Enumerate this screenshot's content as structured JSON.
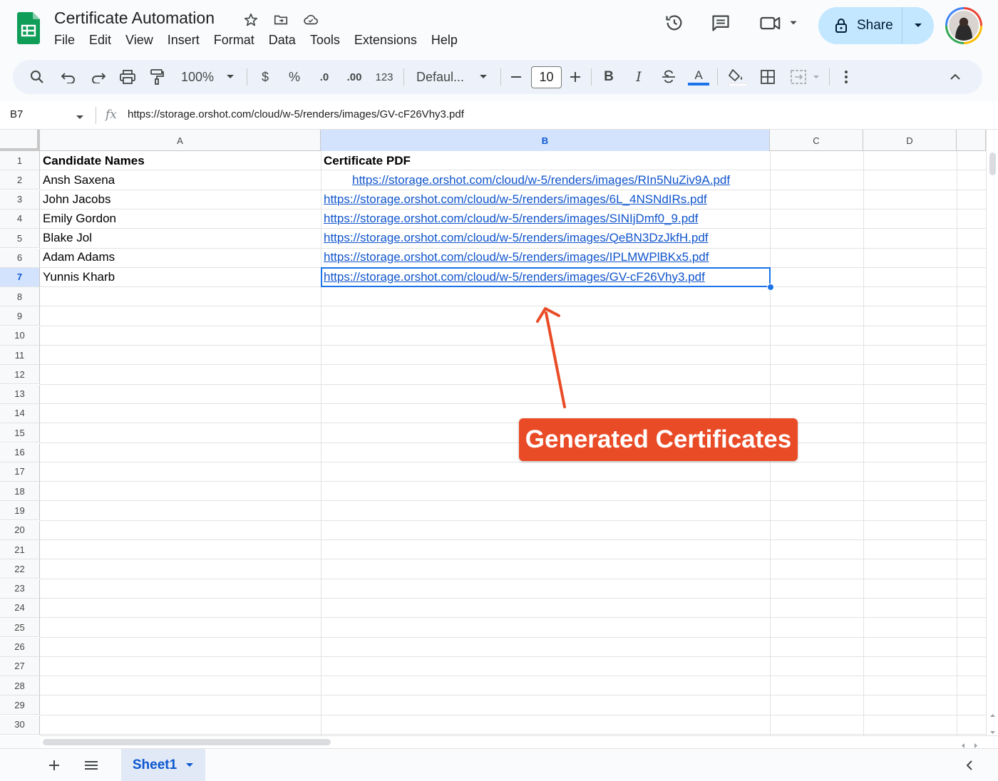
{
  "app": {
    "doc_title": "Certificate Automation",
    "menu": [
      "File",
      "Edit",
      "View",
      "Insert",
      "Format",
      "Data",
      "Tools",
      "Extensions",
      "Help"
    ],
    "share_label": "Share"
  },
  "toolbar": {
    "zoom": "100%",
    "currency": "$",
    "percent": "%",
    "decrease_decimals": ".0",
    "increase_decimals": ".00",
    "number_format": "123",
    "font_family": "Defaul...",
    "font_size": "10",
    "bold": "B",
    "italic": "I",
    "text_color_letter": "A"
  },
  "formula_bar": {
    "cell_ref": "B7",
    "formula": "https://storage.orshot.com/cloud/w-5/renders/images/GV-cF26Vhy3.pdf"
  },
  "grid": {
    "columns": [
      "A",
      "B",
      "C",
      "D"
    ],
    "selected_column": "B",
    "selected_row": "7",
    "row_numbers": [
      "1",
      "2",
      "3",
      "4",
      "5",
      "6",
      "7",
      "8",
      "9",
      "10",
      "11",
      "12",
      "13",
      "14",
      "15",
      "16",
      "17",
      "18",
      "19",
      "20",
      "21",
      "22",
      "23",
      "24",
      "25",
      "26",
      "27",
      "28",
      "29",
      "30"
    ],
    "headers": {
      "a": "Candidate Names",
      "b": "Certificate PDF"
    },
    "rows": [
      {
        "name": "Ansh Saxena",
        "url": "https://storage.orshot.com/cloud/w-5/renders/images/RIn5NuZiv9A.pdf"
      },
      {
        "name": "John Jacobs",
        "url": "https://storage.orshot.com/cloud/w-5/renders/images/6L_4NSNdIRs.pdf"
      },
      {
        "name": "Emily Gordon",
        "url": "https://storage.orshot.com/cloud/w-5/renders/images/SINIjDmf0_9.pdf"
      },
      {
        "name": "Blake Jol",
        "url": "https://storage.orshot.com/cloud/w-5/renders/images/QeBN3DzJkfH.pdf"
      },
      {
        "name": "Adam Adams",
        "url": "https://storage.orshot.com/cloud/w-5/renders/images/IPLMWPlBKx5.pdf"
      },
      {
        "name": "Yunnis Kharb",
        "url": "https://storage.orshot.com/cloud/w-5/renders/images/GV-cF26Vhy3.pdf"
      }
    ]
  },
  "sheets": {
    "active": "Sheet1"
  },
  "annotation": {
    "label": "Generated Certificates",
    "color": "#ea4b27"
  },
  "colors": {
    "accent": "#0b57d0",
    "link": "#1155cc",
    "selection": "#1a73e8",
    "share_bg": "#c2e7ff",
    "sheets_green": "#0f9d58"
  }
}
